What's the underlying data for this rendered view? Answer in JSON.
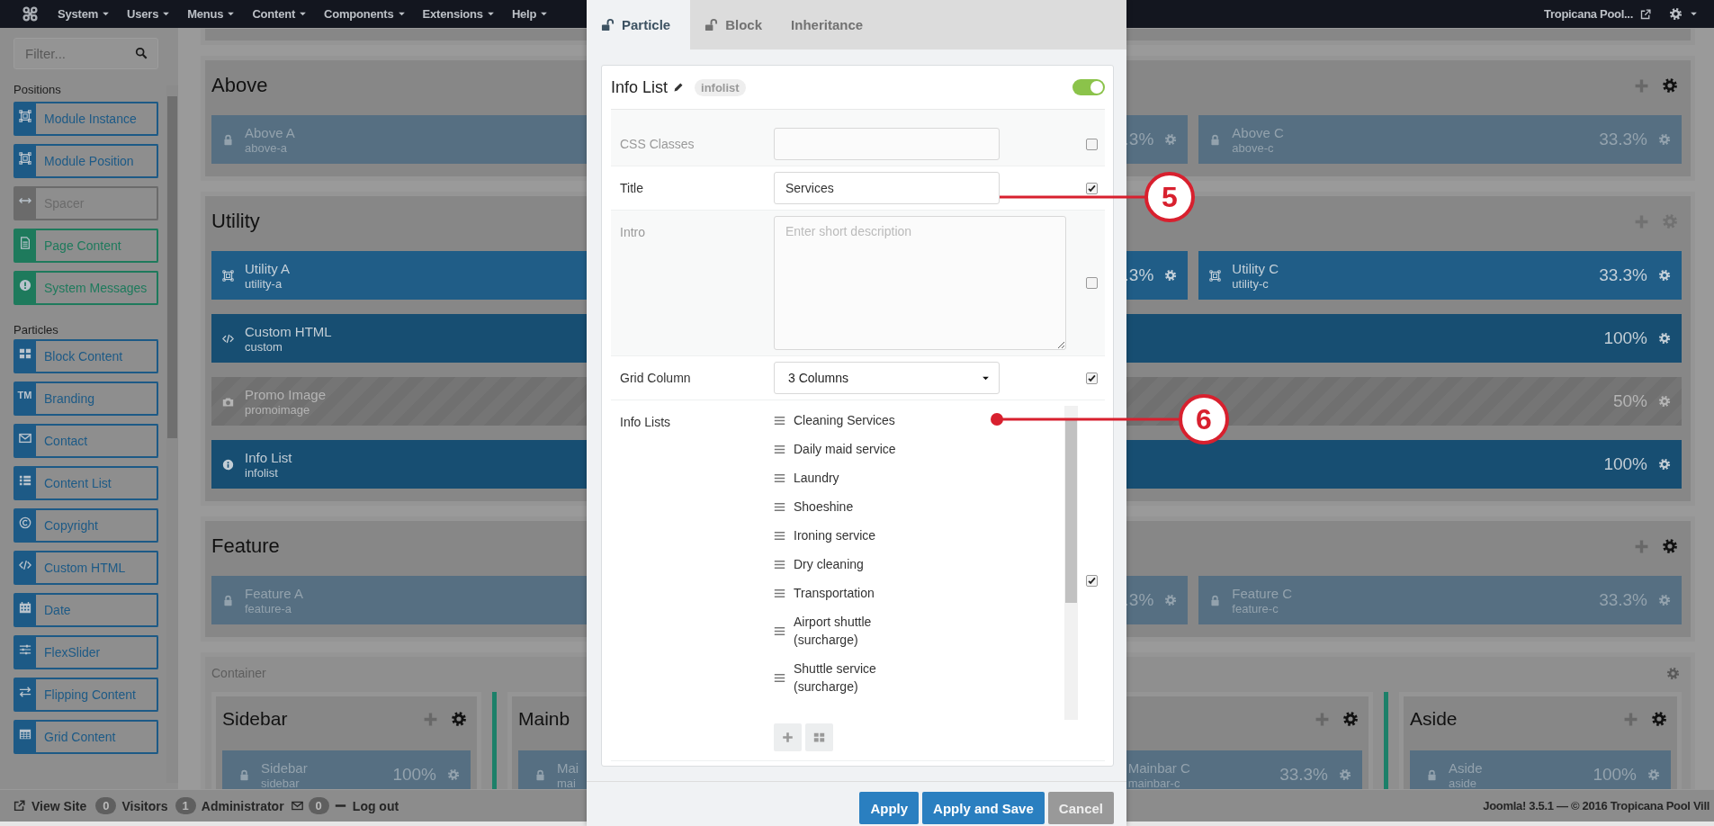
{
  "navbar": {
    "menus": [
      {
        "label": "System"
      },
      {
        "label": "Users"
      },
      {
        "label": "Menus"
      },
      {
        "label": "Content"
      },
      {
        "label": "Components"
      },
      {
        "label": "Extensions"
      },
      {
        "label": "Help"
      }
    ],
    "site": "Tropicana Pool..."
  },
  "sidebar": {
    "filter": {
      "placeholder": "Filter..."
    },
    "groups": [
      {
        "title": "Positions",
        "items": [
          {
            "label": "Module Instance",
            "color": "#1d5a86"
          },
          {
            "label": "Module Position",
            "color": "#1d5a86"
          },
          {
            "label": "Spacer",
            "color": "#6b6b6b"
          },
          {
            "label": "Page Content",
            "color": "#1e7a5c"
          },
          {
            "label": "System Messages",
            "color": "#1e7a5c"
          }
        ]
      },
      {
        "title": "Particles",
        "items": [
          {
            "label": "Block Content",
            "color": "#1d5a86"
          },
          {
            "label": "Branding",
            "color": "#1d5a86",
            "icon_text": "TM"
          },
          {
            "label": "Contact",
            "color": "#1d5a86"
          },
          {
            "label": "Content List",
            "color": "#1d5a86"
          },
          {
            "label": "Copyright",
            "color": "#1d5a86"
          },
          {
            "label": "Custom HTML",
            "color": "#1d5a86"
          },
          {
            "label": "Date",
            "color": "#1d5a86"
          },
          {
            "label": "FlexSlider",
            "color": "#1d5a86"
          },
          {
            "label": "Flipping Content",
            "color": "#1d5a86"
          },
          {
            "label": "Grid Content",
            "color": "#1d5a86"
          }
        ]
      }
    ]
  },
  "layout": {
    "sections": [
      {
        "title": "Above",
        "active": true,
        "rows": [
          {
            "blocks": [
              {
                "kind": "position",
                "title": "Above A",
                "id": "above-a"
              },
              {
                "kind": "position",
                "percent": ".3%"
              },
              {
                "kind": "position",
                "title": "Above C",
                "id": "above-c",
                "percent": "33.3%"
              }
            ]
          }
        ]
      },
      {
        "title": "Utility",
        "active": false,
        "rows": [
          {
            "blocks": [
              {
                "kind": "module",
                "title": "Utility A",
                "id": "utility-a"
              },
              {
                "kind": "module",
                "percent": ".3%"
              },
              {
                "kind": "module",
                "title": "Utility C",
                "id": "utility-c",
                "percent": "33.3%"
              }
            ]
          },
          {
            "blocks": [
              {
                "kind": "html",
                "title": "Custom HTML",
                "id": "custom",
                "percent": "100%"
              }
            ]
          },
          {
            "blocks": [
              {
                "kind": "image",
                "title": "Promo Image",
                "id": "promoimage",
                "percent": "50%"
              }
            ]
          },
          {
            "blocks": [
              {
                "kind": "info",
                "title": "Info List",
                "id": "infolist",
                "percent": "100%"
              }
            ]
          }
        ]
      },
      {
        "title": "Feature",
        "active": true,
        "rows": [
          {
            "blocks": [
              {
                "kind": "position",
                "title": "Feature A",
                "id": "feature-a"
              },
              {
                "kind": "position",
                "percent": ".3%"
              },
              {
                "kind": "position",
                "title": "Feature C",
                "id": "feature-c",
                "percent": "33.3%"
              }
            ]
          }
        ]
      }
    ],
    "container": {
      "label": "Container",
      "columns": [
        {
          "title": "Sidebar",
          "blocks": [
            {
              "kind": "position",
              "title": "Sidebar",
              "id": "sidebar",
              "percent": "100%"
            }
          ]
        },
        {
          "title": "Mainb",
          "blocks": [
            {
              "kind": "position",
              "title": "Mai",
              "id": "mai"
            },
            {
              "kind": "position",
              "title": "Mainbar C",
              "id": "mainbar-c",
              "percent": "33.3%"
            }
          ]
        },
        {
          "title": "Aside",
          "blocks": [
            {
              "kind": "position",
              "title": "Aside",
              "id": "aside",
              "percent": "100%"
            }
          ]
        }
      ]
    }
  },
  "modal": {
    "tabs": [
      {
        "label": "Particle",
        "selected": true
      },
      {
        "label": "Block",
        "selected": false
      },
      {
        "label": "Inheritance",
        "selected": false
      }
    ],
    "card": {
      "title": "Info List",
      "badge": "infolist",
      "enabled": true,
      "fields": [
        {
          "label": "CSS Classes",
          "kind": "text",
          "checked": false
        },
        {
          "label": "Title",
          "kind": "text",
          "value": "Services",
          "checked": true
        },
        {
          "label": "Intro",
          "kind": "textarea",
          "placeholder": "Enter short description",
          "checked": false
        },
        {
          "label": "Grid Column",
          "kind": "select",
          "value": "3 Columns",
          "checked": true
        },
        {
          "label": "Info Lists",
          "kind": "list",
          "checked": true,
          "items": [
            "Cleaning Services",
            "Daily maid service",
            "Laundry",
            "Shoeshine",
            "Ironing service",
            "Dry cleaning",
            "Transportation",
            "Airport shuttle (surcharge)",
            "Shuttle service (surcharge)"
          ]
        }
      ]
    },
    "buttons": [
      {
        "label": "Apply",
        "kind": "primary"
      },
      {
        "label": "Apply and Save",
        "kind": "primary"
      },
      {
        "label": "Cancel",
        "kind": "secondary"
      }
    ]
  },
  "annotations": [
    {
      "number": "5",
      "start_dot": false
    },
    {
      "number": "6",
      "start_dot": true
    }
  ],
  "status_bar": {
    "view_site": "View Site",
    "visitors": {
      "count": "0",
      "label": "Visitors"
    },
    "admins": {
      "count": "1",
      "label": "Administrator"
    },
    "messages": {
      "count": "0"
    },
    "logout": "Log out",
    "footer": "Joomla! 3.5.1 — © 2016 Tropicana Pool Vill"
  }
}
